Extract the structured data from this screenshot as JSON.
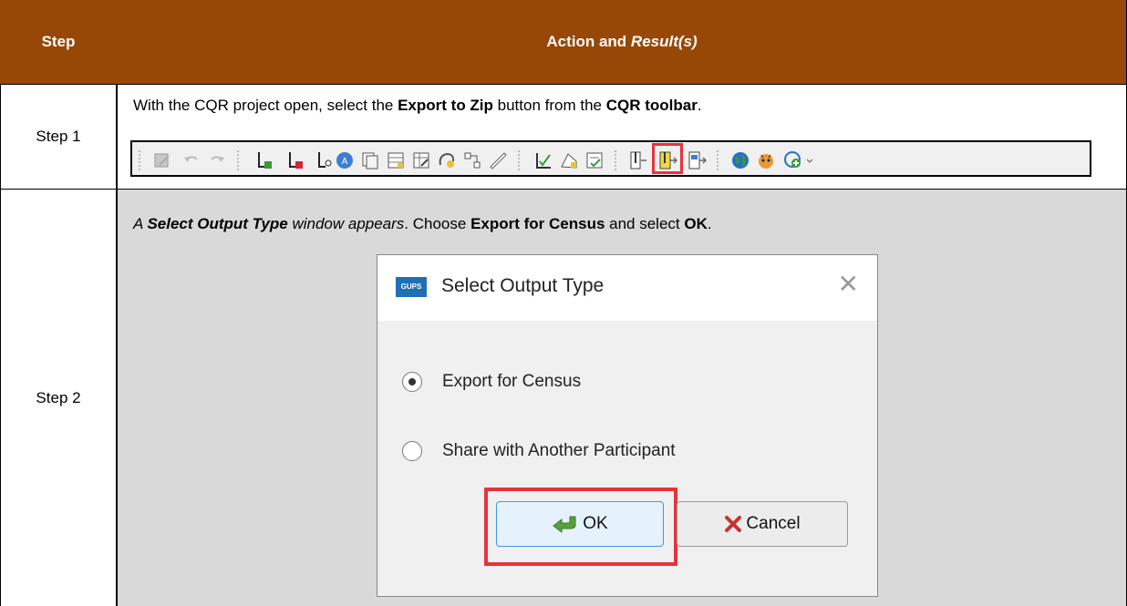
{
  "table": {
    "header": {
      "step": "Step",
      "action_prefix": "Action and ",
      "action_italic": "Result(s)"
    },
    "rows": [
      {
        "step": "Step 1",
        "instruction": {
          "t1": "With the CQR project open, select the ",
          "b1": "Export to Zip",
          "t2": " button from the ",
          "b2": "CQR toolbar",
          "t3": "."
        }
      },
      {
        "step": "Step 2",
        "instruction": {
          "t1": "A ",
          "bi1": "Select Output Type",
          "i2": " window appears",
          "t2": ". Choose ",
          "b1": "Export for Census",
          "t3": " and select ",
          "b2": "OK",
          "t4": "."
        }
      }
    ]
  },
  "toolbar": {
    "icons": [
      "edit-icon",
      "undo-icon",
      "redo-icon",
      "add-feature-icon",
      "delete-feature-icon",
      "split-feature-icon",
      "label-icon",
      "copy-table-icon",
      "table-icon",
      "attribute-table-icon",
      "globe-select-icon",
      "merge-icon",
      "measure-icon",
      "review-icon",
      "shape-icon",
      "checklist-icon",
      "import-zip-icon",
      "export-zip-icon",
      "export-share-icon",
      "globe-icon",
      "tiger-icon",
      "web-globe-icon"
    ]
  },
  "dialog": {
    "logo": "GUPS",
    "title": "Select Output Type",
    "close": "✕",
    "options": [
      {
        "label": "Export for Census",
        "checked": true
      },
      {
        "label": "Share with Another Participant",
        "checked": false
      }
    ],
    "ok_label": "OK",
    "cancel_label": "Cancel"
  },
  "colors": {
    "header_bg": "#974807",
    "row2_bg": "#d9d9d9",
    "highlight": "#e8323c"
  }
}
